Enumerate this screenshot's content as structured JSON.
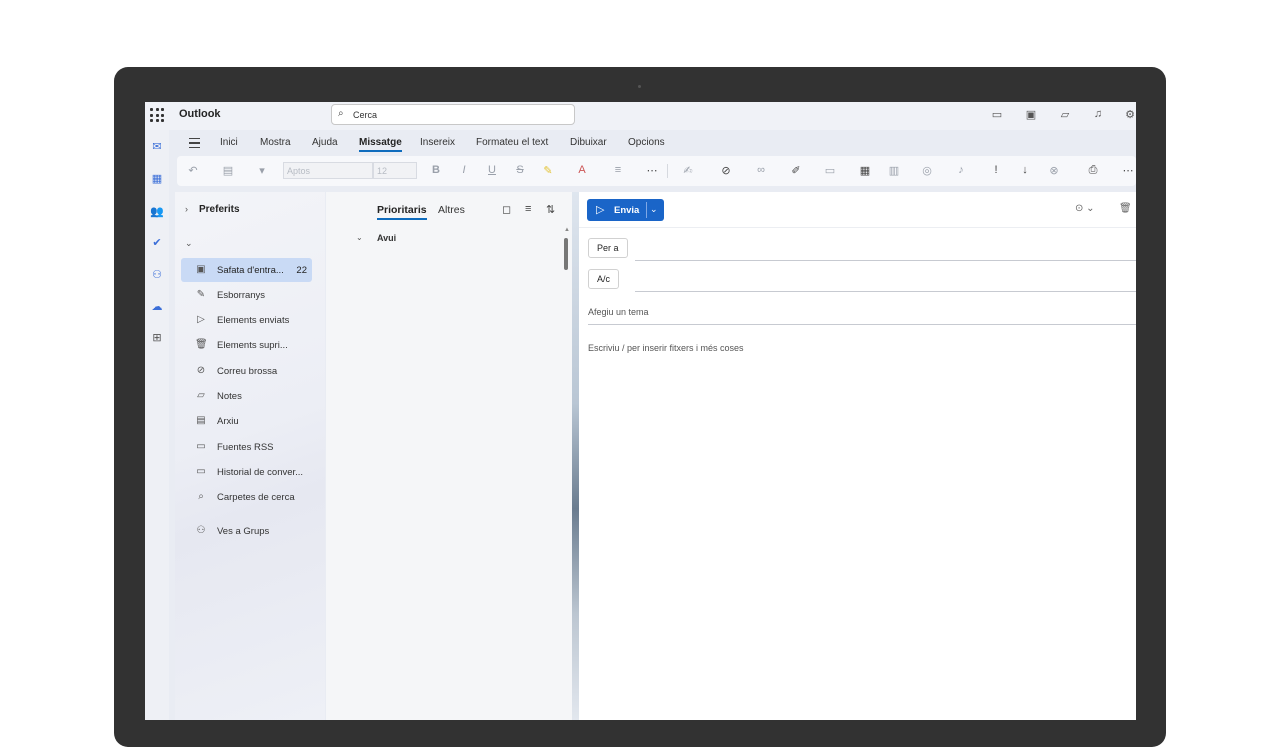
{
  "app": {
    "name": "Outlook"
  },
  "search": {
    "placeholder": "Cerca"
  },
  "menu": {
    "tabs": [
      "Inici",
      "Mostra",
      "Ajuda",
      "Missatge",
      "Insereix",
      "Formateu el text",
      "Dibuixar",
      "Opcions"
    ],
    "active": "Missatge"
  },
  "ribbon": {
    "font_name": "Aptos",
    "font_size": "12"
  },
  "folders": {
    "favorites_label": "Preferits",
    "items": [
      {
        "label": "Safata d'entra...",
        "count": "22",
        "icon": "inbox-icon"
      },
      {
        "label": "Esborranys",
        "icon": "drafts-icon"
      },
      {
        "label": "Elements enviats",
        "icon": "send-icon"
      },
      {
        "label": "Elements supri...",
        "icon": "trash-icon"
      },
      {
        "label": "Correu brossa",
        "icon": "junk-icon"
      },
      {
        "label": "Notes",
        "icon": "notes-icon"
      },
      {
        "label": "Arxiu",
        "icon": "archive-icon"
      },
      {
        "label": "Fuentes RSS",
        "icon": "folder-icon"
      },
      {
        "label": "Historial de conver...",
        "icon": "folder-icon"
      },
      {
        "label": "Carpetes de cerca",
        "icon": "search-folder-icon"
      }
    ],
    "groups_label": "Ves a Grups"
  },
  "message_list": {
    "tab_focused": "Prioritaris",
    "tab_other": "Altres",
    "group_today": "Avui"
  },
  "compose": {
    "send_label": "Envia",
    "to_label": "Per a",
    "cc_label": "A/c",
    "subject_placeholder": "Afegiu un tema",
    "body_placeholder": "Escriviu / per inserir fitxers i més coses"
  },
  "colors": {
    "accent": "#1a65c8",
    "selected_folder": "#c9daf5"
  }
}
